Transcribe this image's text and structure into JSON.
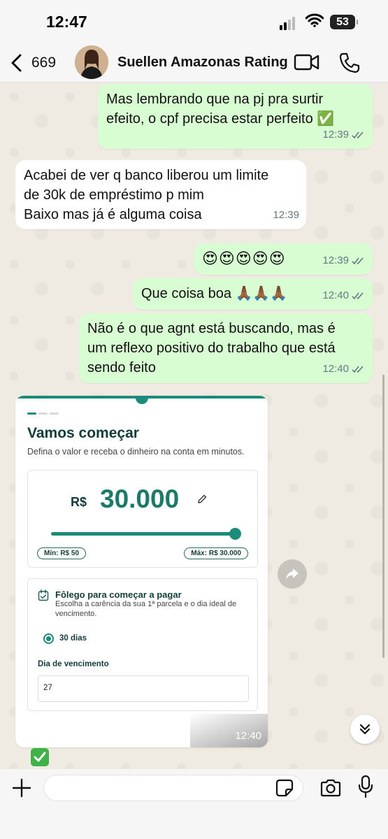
{
  "status_bar": {
    "time": "12:47",
    "battery": "53"
  },
  "header": {
    "unread_count": "669",
    "contact_name": "Suellen Amazonas Rating"
  },
  "messages": [
    {
      "dir": "out",
      "lines": [
        "Mas lembrando que na pj pra surtir",
        "efeito, o cpf precisa estar perfeito ✅"
      ],
      "time": "12:39"
    },
    {
      "dir": "in",
      "lines": [
        "Acabei de ver q banco liberou um limite",
        "de 30k de empréstimo p mim",
        "Baixo mas já é alguma coisa"
      ],
      "time": "12:39"
    },
    {
      "dir": "out",
      "lines": [
        "😍😍😍😍😍"
      ],
      "time": "12:39"
    },
    {
      "dir": "out",
      "lines": [
        "Que coisa boa 🙏🏾🙏🏾🙏🏾"
      ],
      "time": "12:40"
    },
    {
      "dir": "out",
      "lines": [
        "Não é o que agnt está buscando, mas é",
        "um reflexo positivo do trabalho que está",
        "sendo feito"
      ],
      "time": "12:40"
    }
  ],
  "image_message": {
    "time": "12:40",
    "title": "Vamos começar",
    "subtitle": "Defina o valor e receba o dinheiro na conta em minutos.",
    "currency": "R$",
    "amount": "30.000",
    "slider_fraction": 1.0,
    "min_label": "Mín: R$ 50",
    "max_label": "Máx: R$ 30.000",
    "section_title": "Fôlego para começar a pagar",
    "section_sub": "Escolha a carência da sua 1ª parcela e o dia ideal de vencimento.",
    "radio_option": "30 dias",
    "due_label": "Dia de vencimento",
    "due_value": "27"
  },
  "next_message_preview": "✅",
  "colors": {
    "outgoing_bubble": "#d9fdd3",
    "incoming_bubble": "#ffffff",
    "accent": "#1c8c7a",
    "chat_bg": "#efeae2"
  },
  "icons": [
    "back-icon",
    "video-call-icon",
    "phone-icon",
    "edit-icon",
    "calendar-icon",
    "forward-icon",
    "chevron-down-icon",
    "plus-icon",
    "sticker-icon",
    "camera-icon",
    "mic-icon"
  ]
}
